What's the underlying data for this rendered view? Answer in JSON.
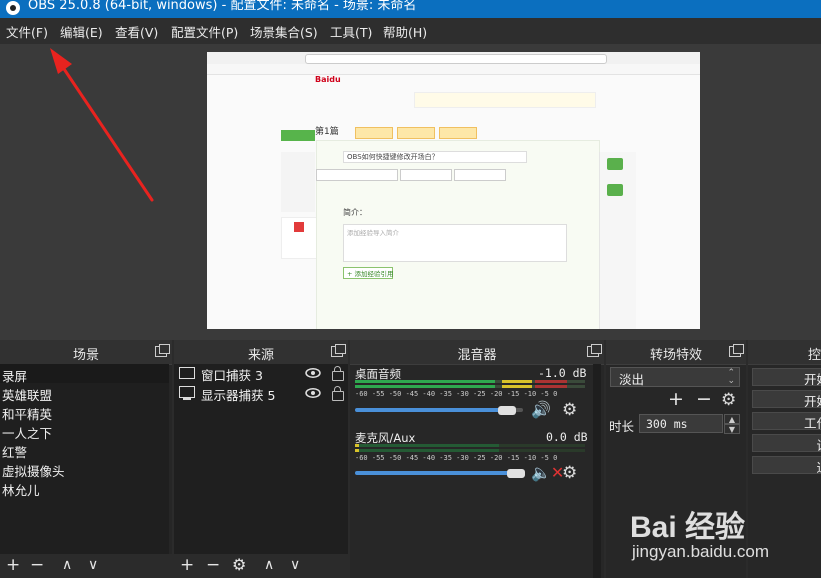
{
  "window": {
    "title": "OBS 25.0.8 (64-bit, windows) - 配置文件: 未命名 - 场景: 未命名"
  },
  "menu": [
    "文件(F)",
    "编辑(E)",
    "查看(V)",
    "配置文件(P)",
    "场景集合(S)",
    "工具(T)",
    "帮助(H)"
  ],
  "preview": {
    "page_heading": "第1篇",
    "question_input": "OBS如何快捷键修改开场白？",
    "intro_label": "简介：",
    "textarea_placeholder": "添加经验导入简介",
    "add_button": "+ 添加经验引用"
  },
  "scenes": {
    "title": "场景",
    "items": [
      "录屏",
      "英雄联盟",
      "和平精英",
      "一人之下",
      "红警",
      "虚拟摄像头",
      "林允儿"
    ]
  },
  "sources": {
    "title": "来源",
    "items": [
      {
        "label": "窗口捕获 3",
        "icon": "window-icon"
      },
      {
        "label": "显示器捕获 5",
        "icon": "monitor-icon"
      }
    ]
  },
  "mixer": {
    "title": "混音器",
    "ticks": "-60 -55 -50 -45 -40 -35 -30 -25 -20 -15 -10 -5 0",
    "channels": [
      {
        "name": "桌面音频",
        "db": "-1.0 dB",
        "volume": 0.88,
        "muted": false
      },
      {
        "name": "麦克风/Aux",
        "db": "0.0 dB",
        "volume": 1.0,
        "muted": true
      }
    ]
  },
  "transitions": {
    "title": "转场特效",
    "selected": "淡出",
    "duration_label": "时长",
    "duration_value": "300 ms"
  },
  "controls": {
    "title": "控",
    "buttons": [
      "开始",
      "开始",
      "工作",
      "设",
      "退"
    ]
  },
  "watermark": {
    "brand": "Bai 经验",
    "url": "jingyan.baidu.com"
  },
  "colors": {
    "titlebar": "#0b6fbf",
    "annotation_arrow": "#e8231f",
    "meter_green": "#2fa84f",
    "meter_yellow": "#d8c22a",
    "meter_red": "#d23b3b",
    "slider": "#4a90d9"
  }
}
